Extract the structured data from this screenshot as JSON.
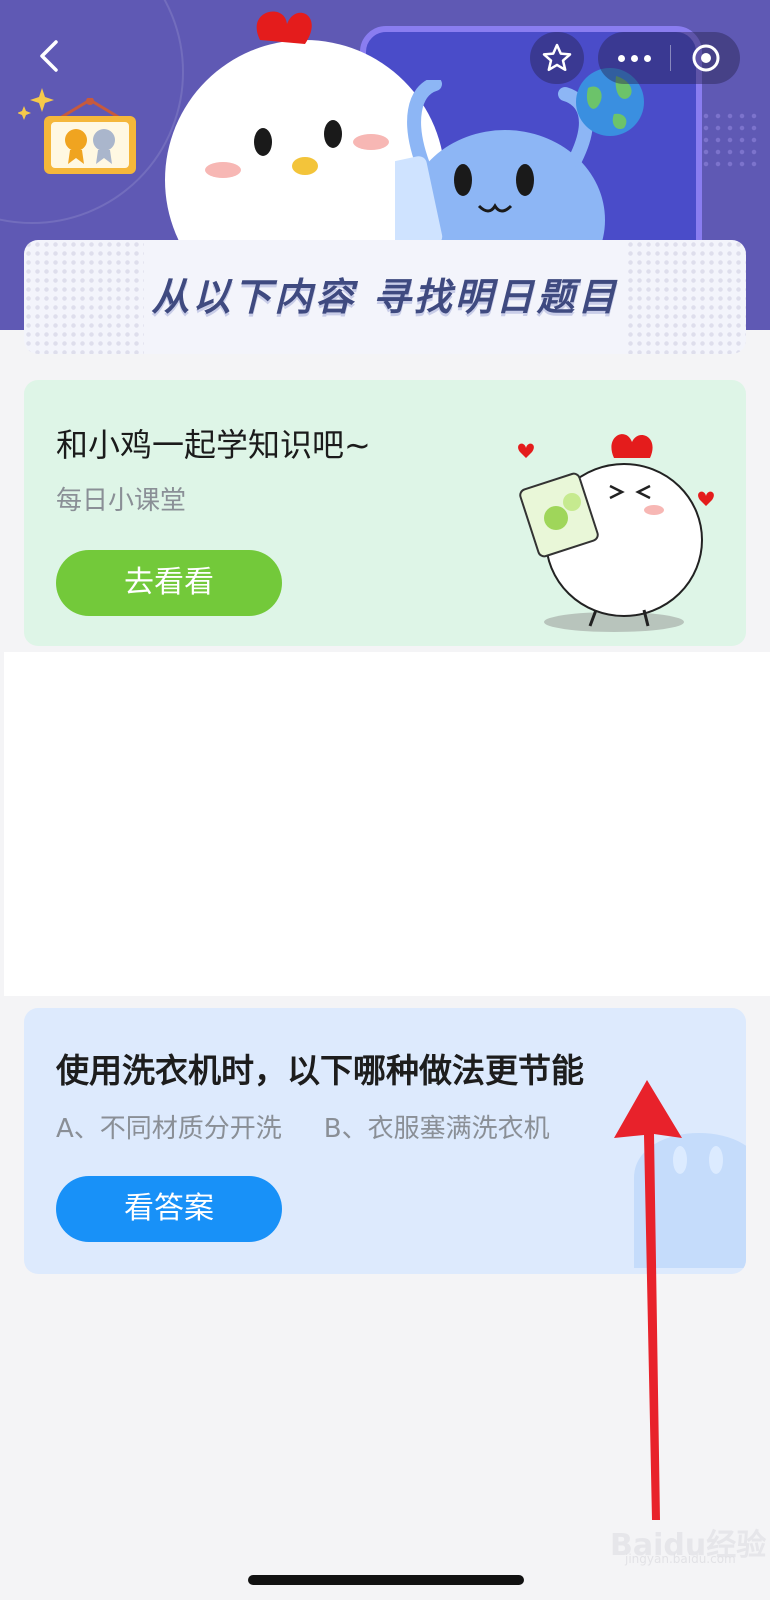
{
  "banner": {
    "title": "从以下内容  寻找明日题目"
  },
  "study_card": {
    "title": "和小鸡一起学知识吧~",
    "subtitle": "每日小课堂",
    "button_label": "去看看"
  },
  "quiz_card": {
    "question": "使用洗衣机时，以下哪种做法更节能",
    "option_a": "A、不同材质分开洗",
    "option_b": "B、衣服塞满洗衣机",
    "button_label": "看答案"
  },
  "watermark": {
    "text": "Baidu经验",
    "sub": "jingyan.baidu.com"
  },
  "colors": {
    "hero_bg": "#5f59b4",
    "green_button": "#73c93a",
    "blue_button": "#1891f8",
    "green_card": "#def5e7",
    "blue_card": "#ddeafd",
    "annotation_arrow": "#e8222b"
  },
  "icons": [
    "back-icon",
    "star-icon",
    "more-icon",
    "target-icon",
    "medal-icon",
    "sparkle-icon",
    "globe-icon",
    "annotation-arrow"
  ]
}
